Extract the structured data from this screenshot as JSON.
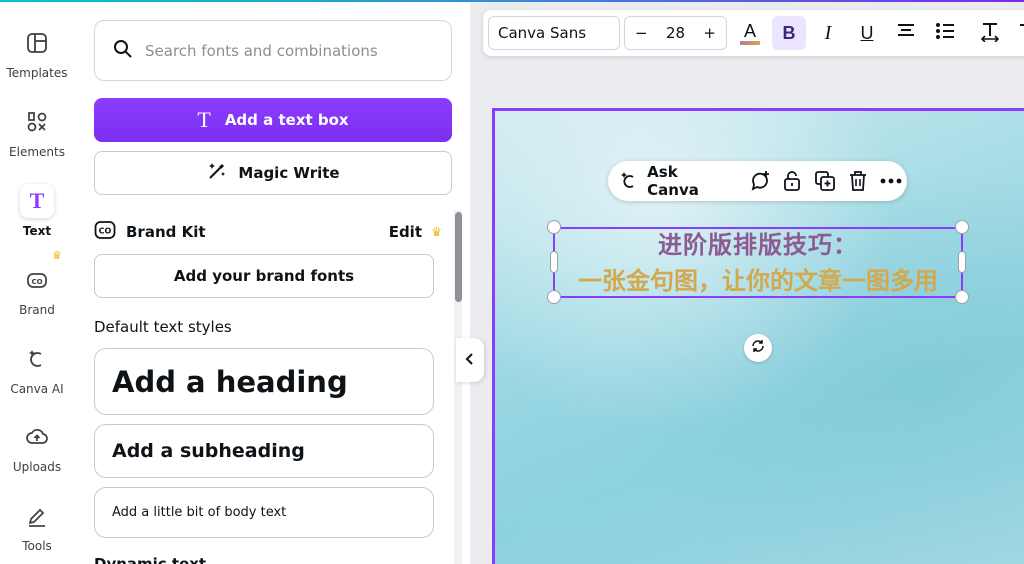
{
  "sidebar": {
    "items": [
      {
        "label": "Templates",
        "icon": "templates-icon"
      },
      {
        "label": "Elements",
        "icon": "elements-icon"
      },
      {
        "label": "Text",
        "icon": "text-icon",
        "active": true
      },
      {
        "label": "Brand",
        "icon": "brand-icon",
        "premium": true
      },
      {
        "label": "Canva AI",
        "icon": "canva-ai-icon"
      },
      {
        "label": "Uploads",
        "icon": "uploads-icon"
      },
      {
        "label": "Tools",
        "icon": "tools-icon"
      }
    ]
  },
  "panel": {
    "search_placeholder": "Search fonts and combinations",
    "add_text_box": "Add a text box",
    "magic_write": "Magic Write",
    "brand_kit": {
      "title": "Brand Kit",
      "edit": "Edit",
      "add_fonts": "Add your brand fonts"
    },
    "default_styles_title": "Default text styles",
    "heading": "Add a heading",
    "subheading": "Add a subheading",
    "body": "Add a little bit of body text",
    "dynamic_text_title": "Dynamic text"
  },
  "toolbar": {
    "font": "Canva Sans",
    "size": "28",
    "minus": "−",
    "plus": "+",
    "color_icon": "text-color-icon",
    "bold": "B",
    "italic": "I",
    "underline": "U"
  },
  "canvas": {
    "ask_canva": "Ask Canva",
    "text_line1": "进阶版排版技巧：",
    "text_line2": "一张金句图，让你的文章一图多用",
    "colors": {
      "accent": "#8b3dff",
      "line1": "#8d5a93",
      "line2": "#d3a84e"
    }
  }
}
